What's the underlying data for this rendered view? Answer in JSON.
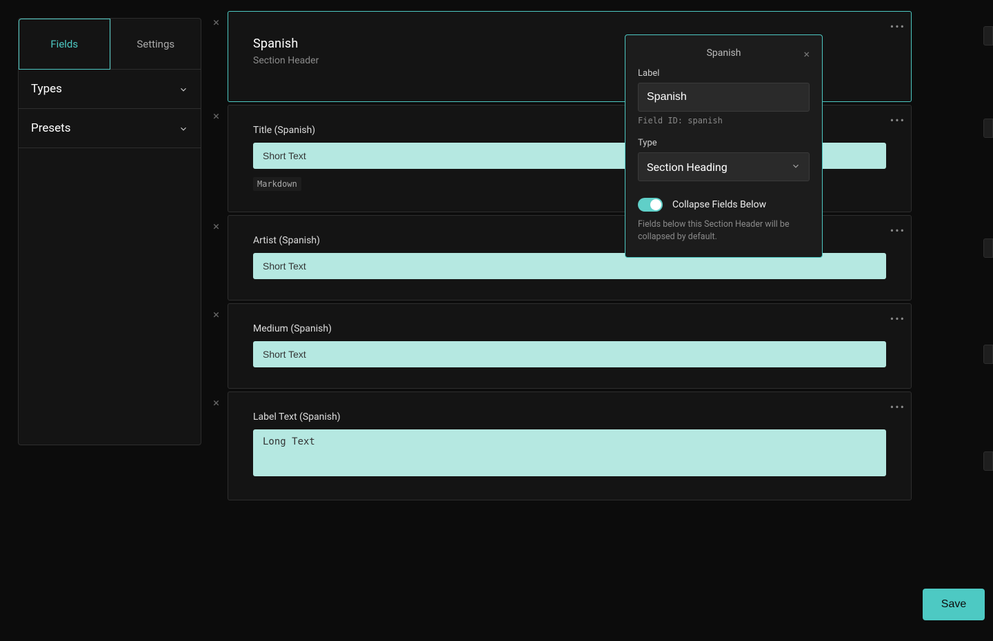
{
  "sidebar": {
    "tabs": {
      "fields": "Fields",
      "settings": "Settings"
    },
    "accordions": {
      "types": "Types",
      "presets": "Presets"
    }
  },
  "cards": [
    {
      "title": "Spanish",
      "subtitle": "Section Header"
    },
    {
      "label": "Title (Spanish)",
      "placeholder": "Short Text",
      "badge": "Markdown"
    },
    {
      "label": "Artist (Spanish)",
      "placeholder": "Short Text"
    },
    {
      "label": "Medium (Spanish)",
      "placeholder": "Short Text"
    },
    {
      "label": "Label Text (Spanish)",
      "placeholder": "Long Text"
    }
  ],
  "popover": {
    "title": "Spanish",
    "label_label": "Label",
    "label_value": "Spanish",
    "field_id": "Field ID: spanish",
    "type_label": "Type",
    "type_value": "Section Heading",
    "toggle_label": "Collapse Fields Below",
    "toggle_desc": "Fields below this Section Header will be collapsed by default."
  },
  "actions": {
    "save": "Save"
  },
  "glyphs": {
    "close": "×",
    "more": "•••"
  }
}
